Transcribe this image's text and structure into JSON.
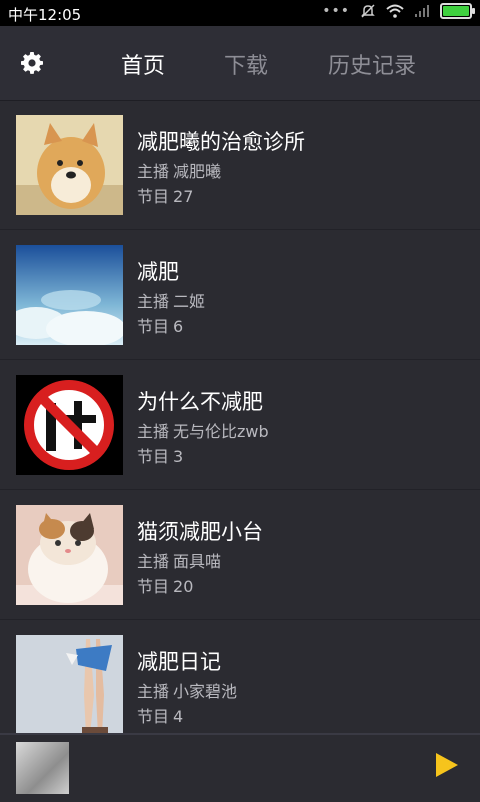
{
  "status_bar": {
    "time": "中午12:05",
    "battery_percent": 100
  },
  "header": {
    "tabs": [
      {
        "label": "首页",
        "active": true
      },
      {
        "label": "下载",
        "active": false
      },
      {
        "label": "历史记录",
        "active": false
      }
    ]
  },
  "list": {
    "host_prefix": "主播",
    "episodes_prefix": "节目",
    "items": [
      {
        "title": "减肥曦的治愈诊所",
        "host": "减肥曦",
        "episodes": "27"
      },
      {
        "title": "减肥",
        "host": "二姬",
        "episodes": "6"
      },
      {
        "title": "为什么不减肥",
        "host": "无与伦比zwb",
        "episodes": "3"
      },
      {
        "title": "猫须减肥小台",
        "host": "面具喵",
        "episodes": "20"
      },
      {
        "title": "减肥日记",
        "host": "小家碧池",
        "episodes": "4"
      }
    ]
  },
  "colors": {
    "accent": "#f6c41c",
    "background": "#2b2b31",
    "battery": "#3fd03f"
  }
}
